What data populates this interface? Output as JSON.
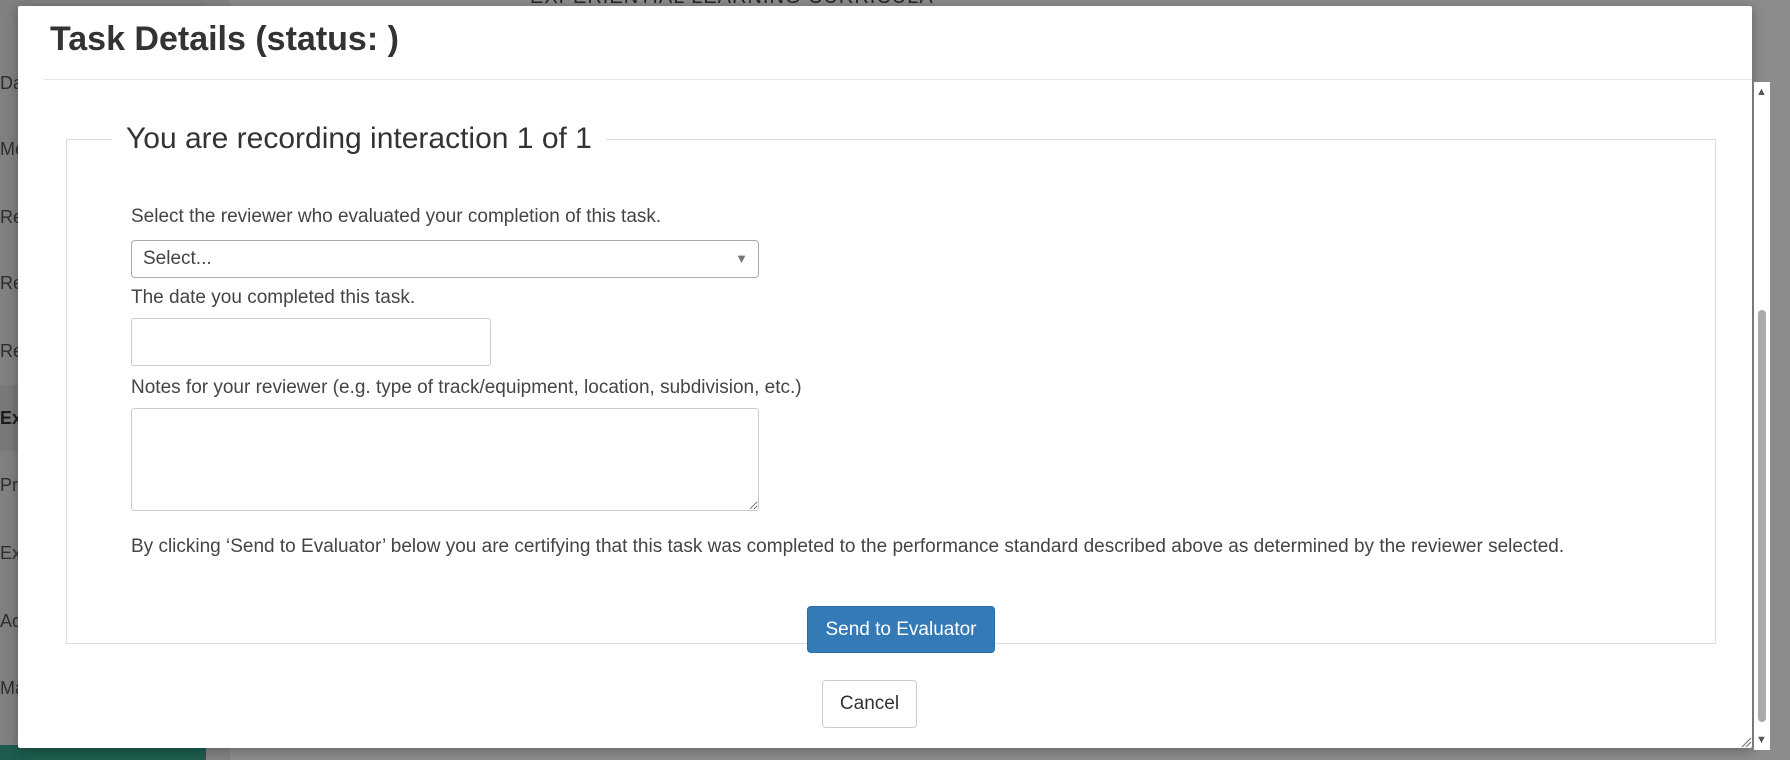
{
  "background": {
    "heading": "EXPERIENTIAL LEARNING CURRICULA",
    "sidebar_items": [
      "Da",
      "Me",
      "Reg",
      "Rec",
      "Rec",
      "Exp",
      "Pri",
      "Ext",
      "Ac",
      "Ma"
    ],
    "active_item_index": 5
  },
  "modal": {
    "title": "Task Details (status: )",
    "legend": "You are recording interaction 1 of 1",
    "reviewer": {
      "label": "Select the reviewer who evaluated your completion of this task.",
      "selected": "Select..."
    },
    "date": {
      "label": "The date you completed this task.",
      "value": ""
    },
    "notes": {
      "label": "Notes for your reviewer (e.g. type of track/equipment, location, subdivision, etc.)",
      "value": ""
    },
    "certify_text": "By clicking ‘Send to Evaluator’ below you are certifying that this task was completed to the performance standard described above as determined by the reviewer selected.",
    "send_label": "Send to Evaluator",
    "cancel_label": "Cancel"
  },
  "colors": {
    "primary": "#337ab7",
    "sidebar_green": "#35a88e"
  }
}
